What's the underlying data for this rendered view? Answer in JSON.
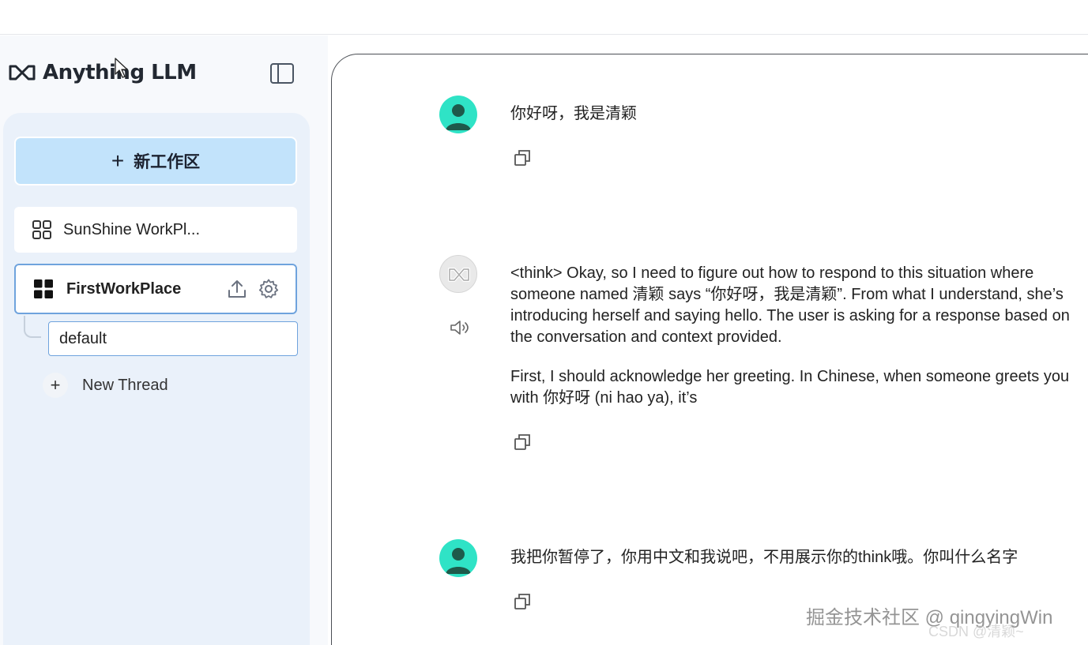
{
  "app": {
    "name": "Anything LLM",
    "logo_icon": "anythingllm-logo-icon",
    "toggle_icon": "sidebar-toggle-icon"
  },
  "sidebar": {
    "new_workspace_label": "新工作区",
    "workspaces": [
      {
        "label": "SunShine WorkPl...",
        "icon": "grid-outline-icon",
        "selected": false
      },
      {
        "label": "FirstWorkPlace",
        "icon": "grid-filled-icon",
        "selected": true
      }
    ],
    "threads": [
      {
        "label": "default",
        "active": true
      }
    ],
    "new_thread_label": "New Thread"
  },
  "chat": {
    "messages": [
      {
        "role": "user",
        "text": "你好呀，我是清颖"
      },
      {
        "role": "assistant",
        "paragraphs": [
          "<think> Okay, so I need to figure out how to respond to this situation where someone named 清颖 says “你好呀，我是清颖”. From what I understand, she’s introducing herself and saying hello. The user is asking for a response based on the conversation and context provided.",
          "First, I should acknowledge her greeting. In Chinese, when someone greets you with 你好呀 (ni hao ya), it’s"
        ]
      },
      {
        "role": "user",
        "text": "我把你暂停了，你用中文和我说吧，不用展示你的think哦。你叫什么名字"
      }
    ]
  },
  "watermark": {
    "primary": "掘金技术社区 @ qingyingWin",
    "secondary": "CSDN @清颖~"
  },
  "colors": {
    "accent_blue": "#c2e3fb",
    "selected_border": "#6fa3dd",
    "user_avatar": "#2fe3c6"
  }
}
